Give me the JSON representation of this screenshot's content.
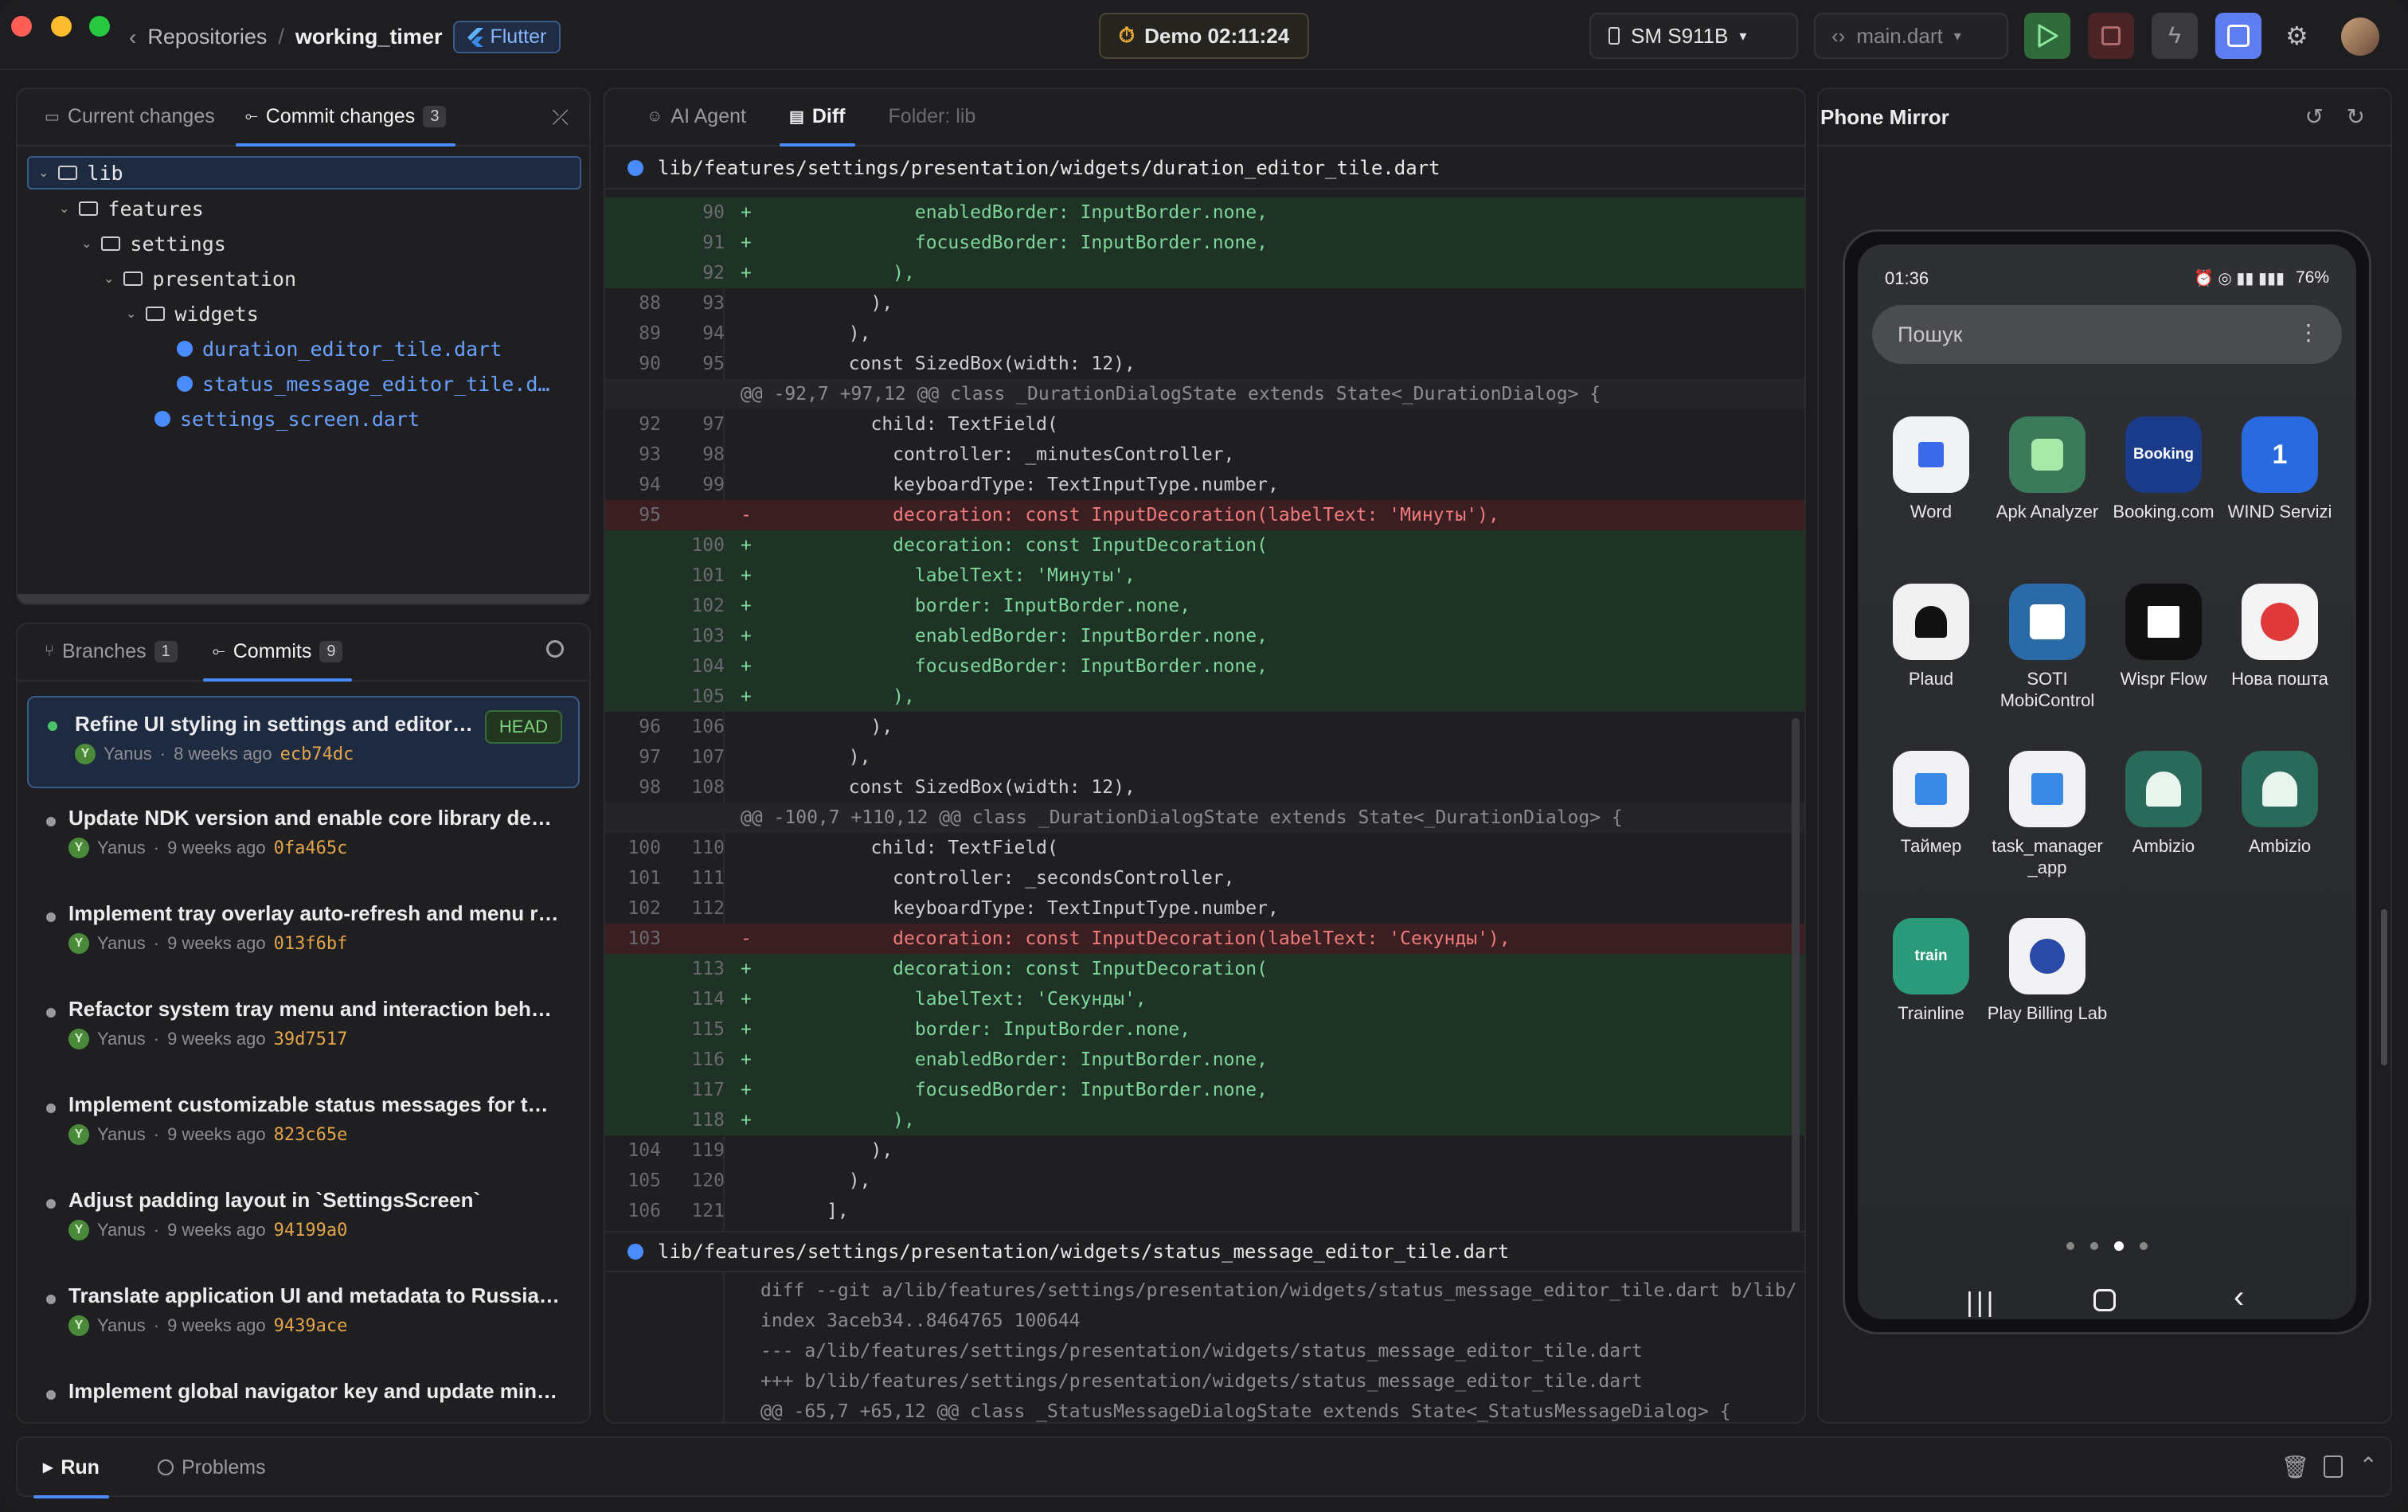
{
  "titlebar": {
    "crumb_root": "Repositories",
    "crumb_sep": "/",
    "crumb_repo": "working_timer",
    "framework_chip": "Flutter",
    "timer_label": "Demo 02:11:24",
    "device": "SM S911B",
    "file": "main.dart"
  },
  "changes": {
    "tab_current": "Current changes",
    "tab_commit": "Commit changes",
    "commit_count": "3",
    "tree": [
      {
        "label": "lib"
      },
      {
        "label": "features"
      },
      {
        "label": "settings"
      },
      {
        "label": "presentation"
      },
      {
        "label": "widgets"
      },
      {
        "label": "duration_editor_tile.dart"
      },
      {
        "label": "status_message_editor_tile.d…"
      },
      {
        "label": "settings_screen.dart"
      }
    ]
  },
  "history": {
    "tab_branches": "Branches",
    "branches_count": "1",
    "tab_commits": "Commits",
    "commits_count": "9",
    "head_label": "HEAD",
    "commits": [
      {
        "msg": "Refine UI styling in settings and editor…",
        "author": "Yanus",
        "when": "8 weeks ago",
        "hash": "ecb74dc"
      },
      {
        "msg": "Update NDK version and enable core library de…",
        "author": "Yanus",
        "when": "9 weeks ago",
        "hash": "0fa465c"
      },
      {
        "msg": "Implement tray overlay auto-refresh and menu r…",
        "author": "Yanus",
        "when": "9 weeks ago",
        "hash": "013f6bf"
      },
      {
        "msg": "Refactor system tray menu and interaction beh…",
        "author": "Yanus",
        "when": "9 weeks ago",
        "hash": "39d7517"
      },
      {
        "msg": "Implement customizable status messages for t…",
        "author": "Yanus",
        "when": "9 weeks ago",
        "hash": "823c65e"
      },
      {
        "msg": "Adjust padding layout in `SettingsScreen`",
        "author": "Yanus",
        "when": "9 weeks ago",
        "hash": "94199a0"
      },
      {
        "msg": "Translate application UI and metadata to Russia…",
        "author": "Yanus",
        "when": "9 weeks ago",
        "hash": "9439ace"
      },
      {
        "msg": "Implement global navigator key and update min…",
        "author": "",
        "when": "",
        "hash": ""
      }
    ]
  },
  "diff": {
    "tab_agent": "AI Agent",
    "tab_diff": "Diff",
    "folder_label": "Folder: lib",
    "file1": "lib/features/settings/presentation/widgets/duration_editor_tile.dart",
    "file2": "lib/features/settings/presentation/widgets/status_message_editor_tile.dart",
    "lines1": [
      {
        "t": "add",
        "o": "",
        "n": "90",
        "s": "+",
        "c": "              enabledBorder: InputBorder.none,"
      },
      {
        "t": "add",
        "o": "",
        "n": "91",
        "s": "+",
        "c": "              focusedBorder: InputBorder.none,"
      },
      {
        "t": "add",
        "o": "",
        "n": "92",
        "s": "+",
        "c": "            ),"
      },
      {
        "t": "ctx",
        "o": "88",
        "n": "93",
        "s": "",
        "c": "          ),"
      },
      {
        "t": "ctx",
        "o": "89",
        "n": "94",
        "s": "",
        "c": "        ),"
      },
      {
        "t": "ctx",
        "o": "90",
        "n": "95",
        "s": "",
        "c": "        const SizedBox(width: 12),"
      },
      {
        "t": "hunk",
        "o": "",
        "n": "",
        "s": "",
        "c": "@@ -92,7 +97,12 @@ class _DurationDialogState extends State<_DurationDialog> {"
      },
      {
        "t": "ctx",
        "o": "92",
        "n": "97",
        "s": "",
        "c": "          child: TextField("
      },
      {
        "t": "ctx",
        "o": "93",
        "n": "98",
        "s": "",
        "c": "            controller: _minutesController,"
      },
      {
        "t": "ctx",
        "o": "94",
        "n": "99",
        "s": "",
        "c": "            keyboardType: TextInputType.number,"
      },
      {
        "t": "del",
        "o": "95",
        "n": "",
        "s": "-",
        "c": "            decoration: const InputDecoration(labelText: 'Минуты'),"
      },
      {
        "t": "add",
        "o": "",
        "n": "100",
        "s": "+",
        "c": "            decoration: const InputDecoration("
      },
      {
        "t": "add",
        "o": "",
        "n": "101",
        "s": "+",
        "c": "              labelText: 'Минуты',"
      },
      {
        "t": "add",
        "o": "",
        "n": "102",
        "s": "+",
        "c": "              border: InputBorder.none,"
      },
      {
        "t": "add",
        "o": "",
        "n": "103",
        "s": "+",
        "c": "              enabledBorder: InputBorder.none,"
      },
      {
        "t": "add",
        "o": "",
        "n": "104",
        "s": "+",
        "c": "              focusedBorder: InputBorder.none,"
      },
      {
        "t": "add",
        "o": "",
        "n": "105",
        "s": "+",
        "c": "            ),"
      },
      {
        "t": "ctx",
        "o": "96",
        "n": "106",
        "s": "",
        "c": "          ),"
      },
      {
        "t": "ctx",
        "o": "97",
        "n": "107",
        "s": "",
        "c": "        ),"
      },
      {
        "t": "ctx",
        "o": "98",
        "n": "108",
        "s": "",
        "c": "        const SizedBox(width: 12),"
      },
      {
        "t": "hunk",
        "o": "",
        "n": "",
        "s": "",
        "c": "@@ -100,7 +110,12 @@ class _DurationDialogState extends State<_DurationDialog> {"
      },
      {
        "t": "ctx",
        "o": "100",
        "n": "110",
        "s": "",
        "c": "          child: TextField("
      },
      {
        "t": "ctx",
        "o": "101",
        "n": "111",
        "s": "",
        "c": "            controller: _secondsController,"
      },
      {
        "t": "ctx",
        "o": "102",
        "n": "112",
        "s": "",
        "c": "            keyboardType: TextInputType.number,"
      },
      {
        "t": "del",
        "o": "103",
        "n": "",
        "s": "-",
        "c": "            decoration: const InputDecoration(labelText: 'Секунды'),"
      },
      {
        "t": "add",
        "o": "",
        "n": "113",
        "s": "+",
        "c": "            decoration: const InputDecoration("
      },
      {
        "t": "add",
        "o": "",
        "n": "114",
        "s": "+",
        "c": "              labelText: 'Секунды',"
      },
      {
        "t": "add",
        "o": "",
        "n": "115",
        "s": "+",
        "c": "              border: InputBorder.none,"
      },
      {
        "t": "add",
        "o": "",
        "n": "116",
        "s": "+",
        "c": "              enabledBorder: InputBorder.none,"
      },
      {
        "t": "add",
        "o": "",
        "n": "117",
        "s": "+",
        "c": "              focusedBorder: InputBorder.none,"
      },
      {
        "t": "add",
        "o": "",
        "n": "118",
        "s": "+",
        "c": "            ),"
      },
      {
        "t": "ctx",
        "o": "104",
        "n": "119",
        "s": "",
        "c": "          ),"
      },
      {
        "t": "ctx",
        "o": "105",
        "n": "120",
        "s": "",
        "c": "        ),"
      },
      {
        "t": "ctx",
        "o": "106",
        "n": "121",
        "s": "",
        "c": "      ],"
      }
    ],
    "lines2": [
      {
        "t": "meta",
        "c": "diff --git a/lib/features/settings/presentation/widgets/status_message_editor_tile.dart b/lib/"
      },
      {
        "t": "meta",
        "c": "index 3aceb34..8464765 100644"
      },
      {
        "t": "meta",
        "c": "--- a/lib/features/settings/presentation/widgets/status_message_editor_tile.dart"
      },
      {
        "t": "meta",
        "c": "+++ b/lib/features/settings/presentation/widgets/status_message_editor_tile.dart"
      },
      {
        "t": "meta",
        "c": "@@ -65,7 +65,12 @@ class _StatusMessageDialogState extends State<_StatusMessageDialog> {"
      }
    ]
  },
  "phone": {
    "title": "Phone Mirror",
    "clock": "01:36",
    "battery": "76%",
    "search_placeholder": "Пошук",
    "apps": [
      {
        "label": "Word",
        "icon": "word-icon"
      },
      {
        "label": "Apk Analyzer",
        "icon": "apk-analyzer-icon"
      },
      {
        "label": "Booking.com",
        "icon": "booking-icon",
        "glyph": "Booking"
      },
      {
        "label": "WIND Servizi",
        "icon": "wind-icon",
        "glyph": "1"
      },
      {
        "label": "Plaud",
        "icon": "plaud-icon"
      },
      {
        "label": "SOTI MobiControl",
        "icon": "soti-icon"
      },
      {
        "label": "Wispr Flow",
        "icon": "wispr-icon"
      },
      {
        "label": "Нова пошта",
        "icon": "nova-poshta-icon"
      },
      {
        "label": "Таймер",
        "icon": "flutter-icon"
      },
      {
        "label": "task_manager _app",
        "icon": "flutter-icon"
      },
      {
        "label": "Ambizio",
        "icon": "android-icon"
      },
      {
        "label": "Ambizio",
        "icon": "android-icon"
      },
      {
        "label": "Trainline",
        "icon": "trainline-icon",
        "glyph": "train"
      },
      {
        "label": "Play Billing Lab",
        "icon": "play-billing-icon"
      }
    ]
  },
  "bottom": {
    "tab_run": "Run",
    "tab_problems": "Problems"
  },
  "colors": {
    "accent": "#4a8cff",
    "add_bg": "#1e3326",
    "del_bg": "#3a1e22",
    "hash": "#e3a54a"
  }
}
